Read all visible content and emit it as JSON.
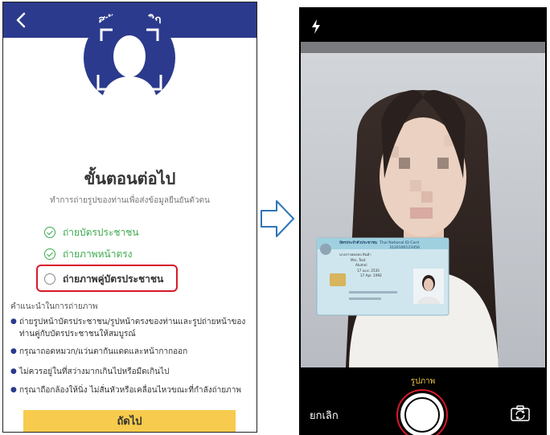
{
  "left_screen": {
    "header_title": "สมัครสมาชิก",
    "back_icon": "chevron-left-icon",
    "steps_title": "ขั้นตอนต่อไป",
    "steps_subtitle": "ทำการถ่ายรูปของท่านเพื่อส่งข้อมูลยืนยันตัวตน",
    "steps": [
      {
        "label": "ถ่ายบัตรประชาชน",
        "status": "done"
      },
      {
        "label": "ถ่ายภาพหน้าตรง",
        "status": "done"
      },
      {
        "label": "ถ่ายภาพคู่บัตรประชาชน",
        "status": "pending"
      }
    ],
    "tips_heading": "คำแนะนำในการถ่ายภาพ",
    "tips": [
      "ถ่ายรูปหน้าบัตรประชาชน/รูปหน้าตรงของท่านและรูปถ่ายหน้าของท่านคู่กับบัตรประชาชนให้สมบูรณ์",
      "กรุณาถอดหมวก/แว่นตากันแดดและหน้ากากออก",
      "ไม่ควรอยู่ในที่สว่างมากเกินไปหรือมืดเกินไป",
      "กรุณาถือกล้องให้นิ่ง ไม่สั่นหัวหรือเคลื่อนไหวขณะที่กำลังถ่ายภาพ"
    ],
    "next_button": "ถัดไป"
  },
  "arrow_icon": "arrow-right-outline-icon",
  "right_screen": {
    "flash_icon": "flash-icon",
    "id_card": {
      "header_thai": "บัตรประจำตัวประชาชน",
      "header_en": "Thai National ID Card",
      "id_number": "3120100123456",
      "name_thai": "นางสาวทดสอบ สินค้า",
      "name_en": "Mrs. Test",
      "lastname_en": "Alumni",
      "dob_thai": "17 เม.ย. 2535",
      "dob_en": "17 Apr. 1992"
    },
    "mode_label": "รูปภาพ",
    "cancel_button": "ยกเลิก",
    "switch_camera_icon": "camera-switch-icon"
  },
  "colors": {
    "header_blue": "#2b3a8c",
    "check_green": "#3caa4e",
    "highlight_red": "#d7192a",
    "button_yellow": "#f7cb4d",
    "mode_label_yellow": "#e8c547"
  }
}
